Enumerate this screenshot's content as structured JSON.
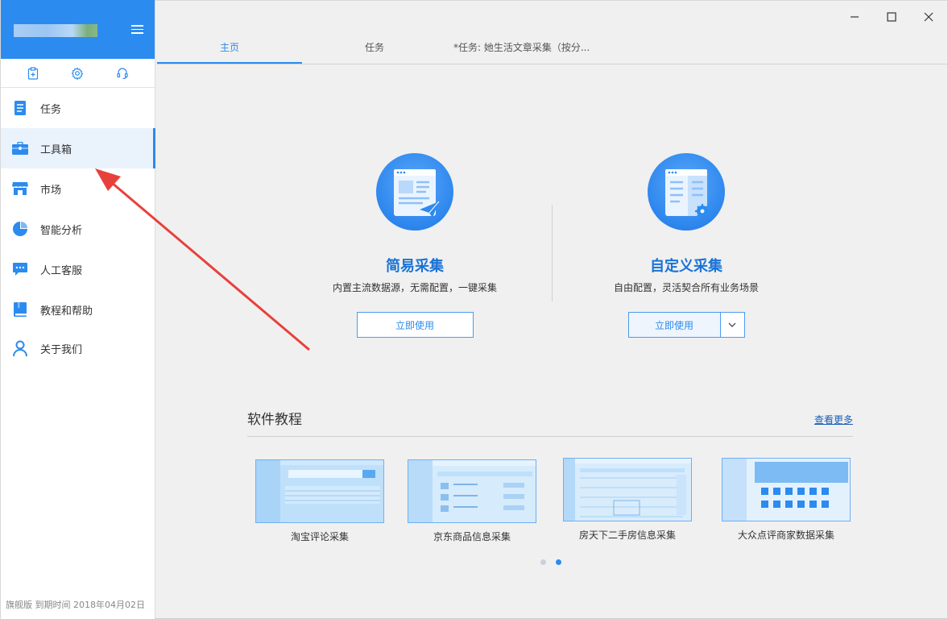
{
  "sidebar": {
    "nav": [
      {
        "label": "任务",
        "icon": "document-icon"
      },
      {
        "label": "工具箱",
        "icon": "toolbox-icon"
      },
      {
        "label": "市场",
        "icon": "store-icon"
      },
      {
        "label": "智能分析",
        "icon": "pie-chart-icon"
      },
      {
        "label": "人工客服",
        "icon": "chat-icon"
      },
      {
        "label": "教程和帮助",
        "icon": "book-icon"
      },
      {
        "label": "关于我们",
        "icon": "user-icon"
      }
    ],
    "active_index": 1,
    "footer": "旗舰版  到期时间  2018年04月02日"
  },
  "tabs": [
    {
      "label": "主页"
    },
    {
      "label": "任务"
    },
    {
      "label": "*任务: 她生活文章采集（按分..."
    }
  ],
  "cards": {
    "simple": {
      "title": "简易采集",
      "desc": "内置主流数据源，无需配置，一键采集",
      "button": "立即使用"
    },
    "custom": {
      "title": "自定义采集",
      "desc": "自由配置，灵活契合所有业务场景",
      "button": "立即使用"
    }
  },
  "tutorial": {
    "title": "软件教程",
    "more": "查看更多",
    "items": [
      {
        "caption": "淘宝评论采集"
      },
      {
        "caption": "京东商品信息采集"
      },
      {
        "caption": "房天下二手房信息采集"
      },
      {
        "caption": "大众点评商家数据采集"
      }
    ],
    "page": 2,
    "pages": 2
  },
  "colors": {
    "accent": "#2b8bef",
    "title_blue": "#1a73d6",
    "arrow": "#e8413b"
  }
}
